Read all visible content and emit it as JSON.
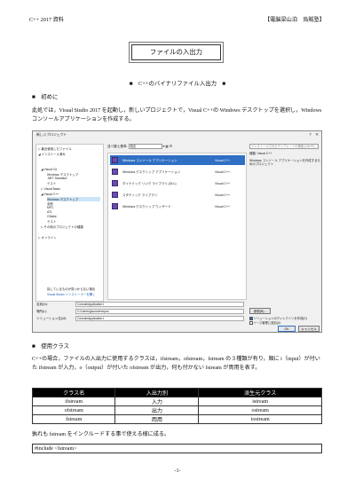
{
  "header": {
    "left": "C++ 2017 資料",
    "right": "【電脳梁山泊　烏賊塾】"
  },
  "title": "ファイルの入出力",
  "subtitle": "■　C++のバイナリファイル入出力　■",
  "sections": {
    "intro": {
      "heading": "■　初めに",
      "body": "此処では，Visual Studio 2017 を起動し，新しいプロジェクトで，Visual C++の Windows デスクトップを選択し，Windows コンソールアプリケーションを作成する。"
    },
    "classes": {
      "heading": "■　使用クラス",
      "body": "C++の場合，ファイルの入出力に使用するクラスは，ifstream，ofstream，fstream の３種類が有り，順に i（input）が付いた ifstream が入力，o（output）が付いた ofstream が出力，何も付かない fstream が両用を表す。"
    }
  },
  "dialog": {
    "title": "新しいプロジェクト",
    "window_buttons": "?　✕",
    "tree": [
      "▷ 最近使用したファイル",
      "◢ インストール済み",
      "◢ Visual C#",
      "Windows デスクトップ",
      ".NET Standard",
      "テスト",
      "▷ Visual Basic",
      "◢ Visual C++",
      "Windows デスクトップ",
      "全般",
      "MFC",
      "ATL",
      "CMake",
      "テスト",
      "▷ その他のプロジェクトの種類",
      "▷ オンライン"
    ],
    "tree_footer_1": "探しているものが見つからない場合",
    "tree_footer_2": "Visual Studio インストーラーを開く",
    "toolbar": {
      "framework_label": "並べ替え基準:",
      "sort_value": "既定"
    },
    "templates": [
      {
        "name": "Windows コンソール アプリケーション",
        "lang": "Visual C++"
      },
      {
        "name": "Windows デスクトップ アプリケーション",
        "lang": "Visual C++"
      },
      {
        "name": "ダイナミック リンク ライブラリ (DLL)",
        "lang": "Visual C++"
      },
      {
        "name": "スタティック ライブラリ",
        "lang": "Visual C++"
      },
      {
        "name": "Windows デスクトップ ウィザード",
        "lang": "Visual C++"
      }
    ],
    "search_placeholder": "インストールされたテンプレートの検索 (Ctrl+E)",
    "info_type": "種類: Visual C++",
    "info_desc": "Windows コンソール アプリケーションを作成するためのプロジェクト",
    "form": {
      "name_label": "名前(N):",
      "name_value": "ConsoleApplication1",
      "location_label": "場所(L):",
      "location_value": "C:\\Users\\g\\source\\repos",
      "solution_label": "ソリューション名(M):",
      "solution_value": "ConsoleApplication1",
      "browse": "参照(B)...",
      "chk_dir": "ソリューションのディレクトリを作成(D)",
      "chk_git": "ソース管理に追加(U)",
      "ok": "OK",
      "cancel": "キャンセル"
    }
  },
  "table": {
    "headers": [
      "クラス名",
      "入出力別",
      "派生元クラス"
    ],
    "rows": [
      [
        "ifstream",
        "入力",
        "istream"
      ],
      [
        "ofstream",
        "出力",
        "ostream"
      ],
      [
        "fstream",
        "両用",
        "iostream"
      ]
    ]
  },
  "after_table": "孰れも fstream をインクルードする事で使える様に成る。",
  "code": "#include <fstream>",
  "page_number": "-1-"
}
